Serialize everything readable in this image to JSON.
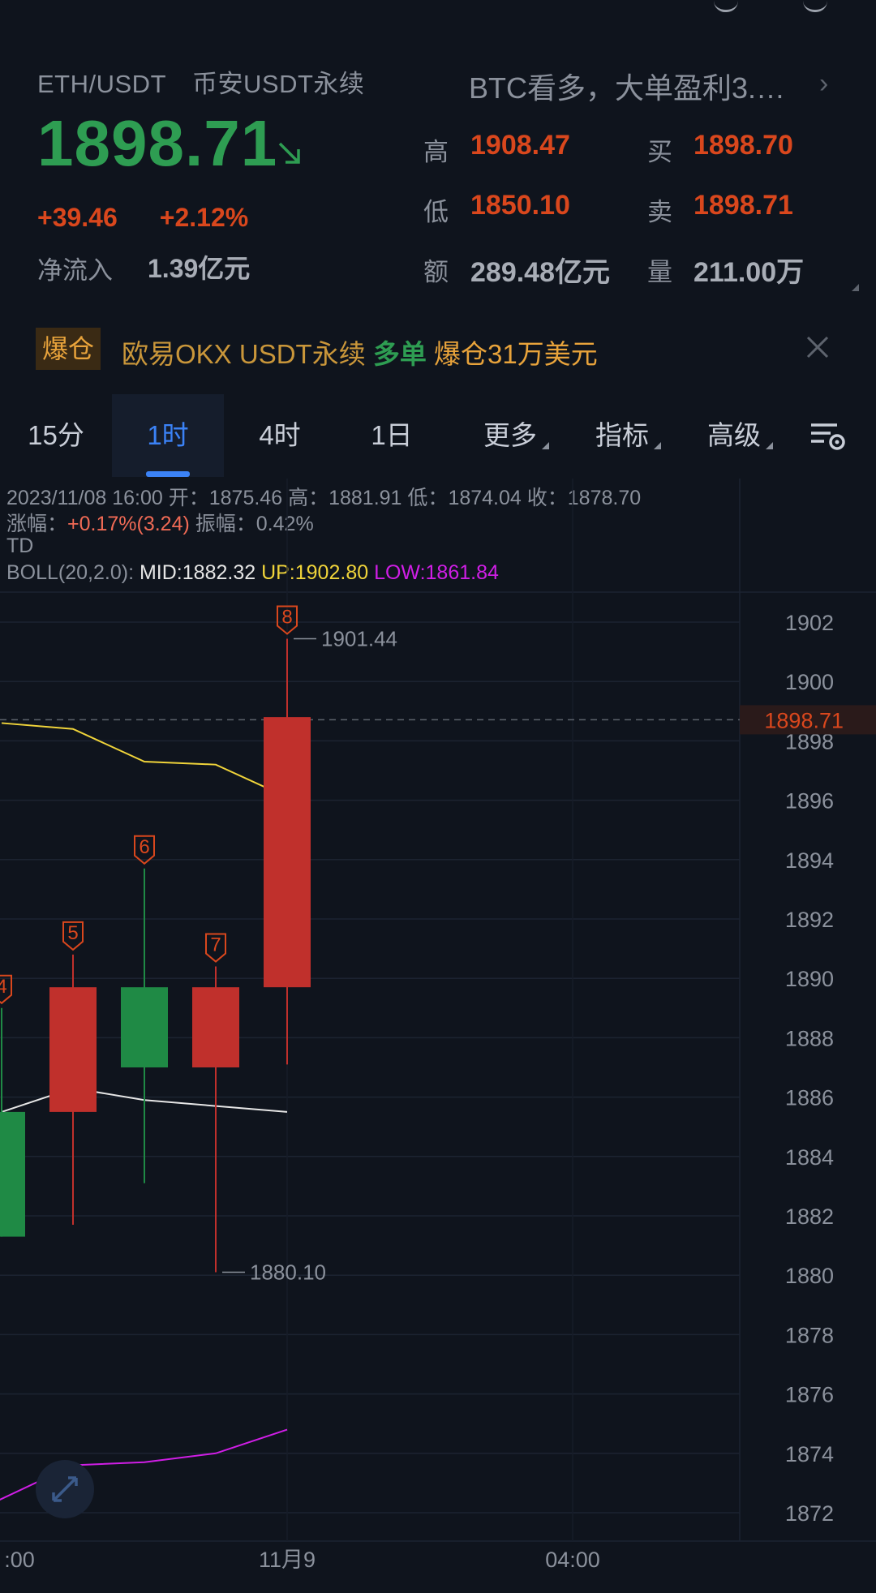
{
  "header": {
    "pair": "ETH/USDT",
    "market": "币安USDT永续",
    "price": "1898.71",
    "change_abs": "+39.46",
    "change_pct": "+2.12%",
    "netflow_label": "净流入",
    "netflow_value": "1.39亿元",
    "news": "BTC看多，大单盈利3.…",
    "stats": [
      {
        "label": "高",
        "value": "1908.47"
      },
      {
        "label": "买",
        "value": "1898.70"
      },
      {
        "label": "低",
        "value": "1850.10"
      },
      {
        "label": "卖",
        "value": "1898.71"
      },
      {
        "label": "额",
        "value": "289.48亿元"
      },
      {
        "label": "量",
        "value": "211.00万"
      }
    ]
  },
  "liquidation": {
    "badge": "爆仓",
    "exchange": "欧易OKX USDT永续",
    "side": "多单",
    "amount": "爆仓31万美元"
  },
  "tabs": [
    "15分",
    "1时",
    "4时",
    "1日",
    "更多",
    "指标",
    "高级"
  ],
  "active_tab": 1,
  "icons": {
    "price_arrow": "arrow-down-right-icon",
    "news_chevron": "chevron-right-icon",
    "close": "close-icon",
    "chart_settings": "chart-settings-icon",
    "expand": "expand-icon"
  },
  "colors": {
    "up": "#d9471d",
    "candle_up": "#c0302c",
    "candle_down": "#1f8a45",
    "price_green": "#2e9d52",
    "accent_blue": "#3b82f6",
    "boll_mid": "#e6e6e6",
    "boll_up": "#f0d43a",
    "boll_low": "#d01ee6"
  },
  "ohlc_info": {
    "datetime": "2023/11/08 16:00",
    "open_label": "开：",
    "open": "1875.46",
    "high_label": "高：",
    "high": "1881.91",
    "low_label": "低：",
    "low": "1874.04",
    "close_label": "收：",
    "close": "1878.70",
    "change_label": "涨幅：",
    "change": "+0.17%(3.24)",
    "amp_label": "振幅：",
    "amplitude": "0.42%",
    "indicator": "TD",
    "boll_label": "BOLL(20,2.0):",
    "boll_mid": "MID:1882.32",
    "boll_up": "UP:1902.80",
    "boll_low": "LOW:1861.84"
  },
  "chart_data": {
    "type": "candlestick",
    "ylim": [
      1871,
      1904
    ],
    "y_ticks": [
      1902,
      1900,
      1898,
      1896,
      1894,
      1892,
      1890,
      1888,
      1886,
      1884,
      1882,
      1880,
      1878,
      1876,
      1874,
      1872
    ],
    "current_price": "1898.71",
    "x_ticks": [
      {
        "label": ":00",
        "slot": -0.5
      },
      {
        "label": "11月9",
        "slot": 4
      },
      {
        "label": "04:00",
        "slot": 8
      }
    ],
    "candles": [
      {
        "slot": 0,
        "open": 1885.5,
        "high": 1889.0,
        "low": 1881.3,
        "close": 1881.3,
        "td": "4"
      },
      {
        "slot": 1,
        "open": 1885.5,
        "high": 1890.8,
        "low": 1881.7,
        "close": 1889.7,
        "td": "5"
      },
      {
        "slot": 2,
        "open": 1889.7,
        "high": 1893.7,
        "low": 1883.1,
        "close": 1887.0,
        "td": "6"
      },
      {
        "slot": 3,
        "open": 1887.0,
        "high": 1890.4,
        "low": 1880.1,
        "close": 1889.7,
        "td": "7"
      },
      {
        "slot": 4,
        "open": 1889.7,
        "high": 1901.44,
        "low": 1887.1,
        "close": 1898.8,
        "td": "8"
      }
    ],
    "annotations": [
      {
        "label": "1901.44",
        "slot": 4,
        "y": 1901.44
      },
      {
        "label": "1880.10",
        "slot": 3,
        "y": 1880.1
      }
    ],
    "boll_mid": [
      [
        0,
        1885.5
      ],
      [
        1,
        1886.3
      ],
      [
        2,
        1885.9
      ],
      [
        3,
        1885.7
      ],
      [
        4,
        1885.5
      ]
    ],
    "boll_up": [
      [
        0,
        1898.6
      ],
      [
        1,
        1898.4
      ],
      [
        2,
        1897.3
      ],
      [
        3,
        1897.2
      ],
      [
        4,
        1896.1
      ]
    ],
    "boll_low": [
      [
        -0.5,
        1871.9
      ],
      [
        1,
        1873.6
      ],
      [
        2,
        1873.7
      ],
      [
        3,
        1874.0
      ],
      [
        4,
        1874.8
      ]
    ]
  }
}
